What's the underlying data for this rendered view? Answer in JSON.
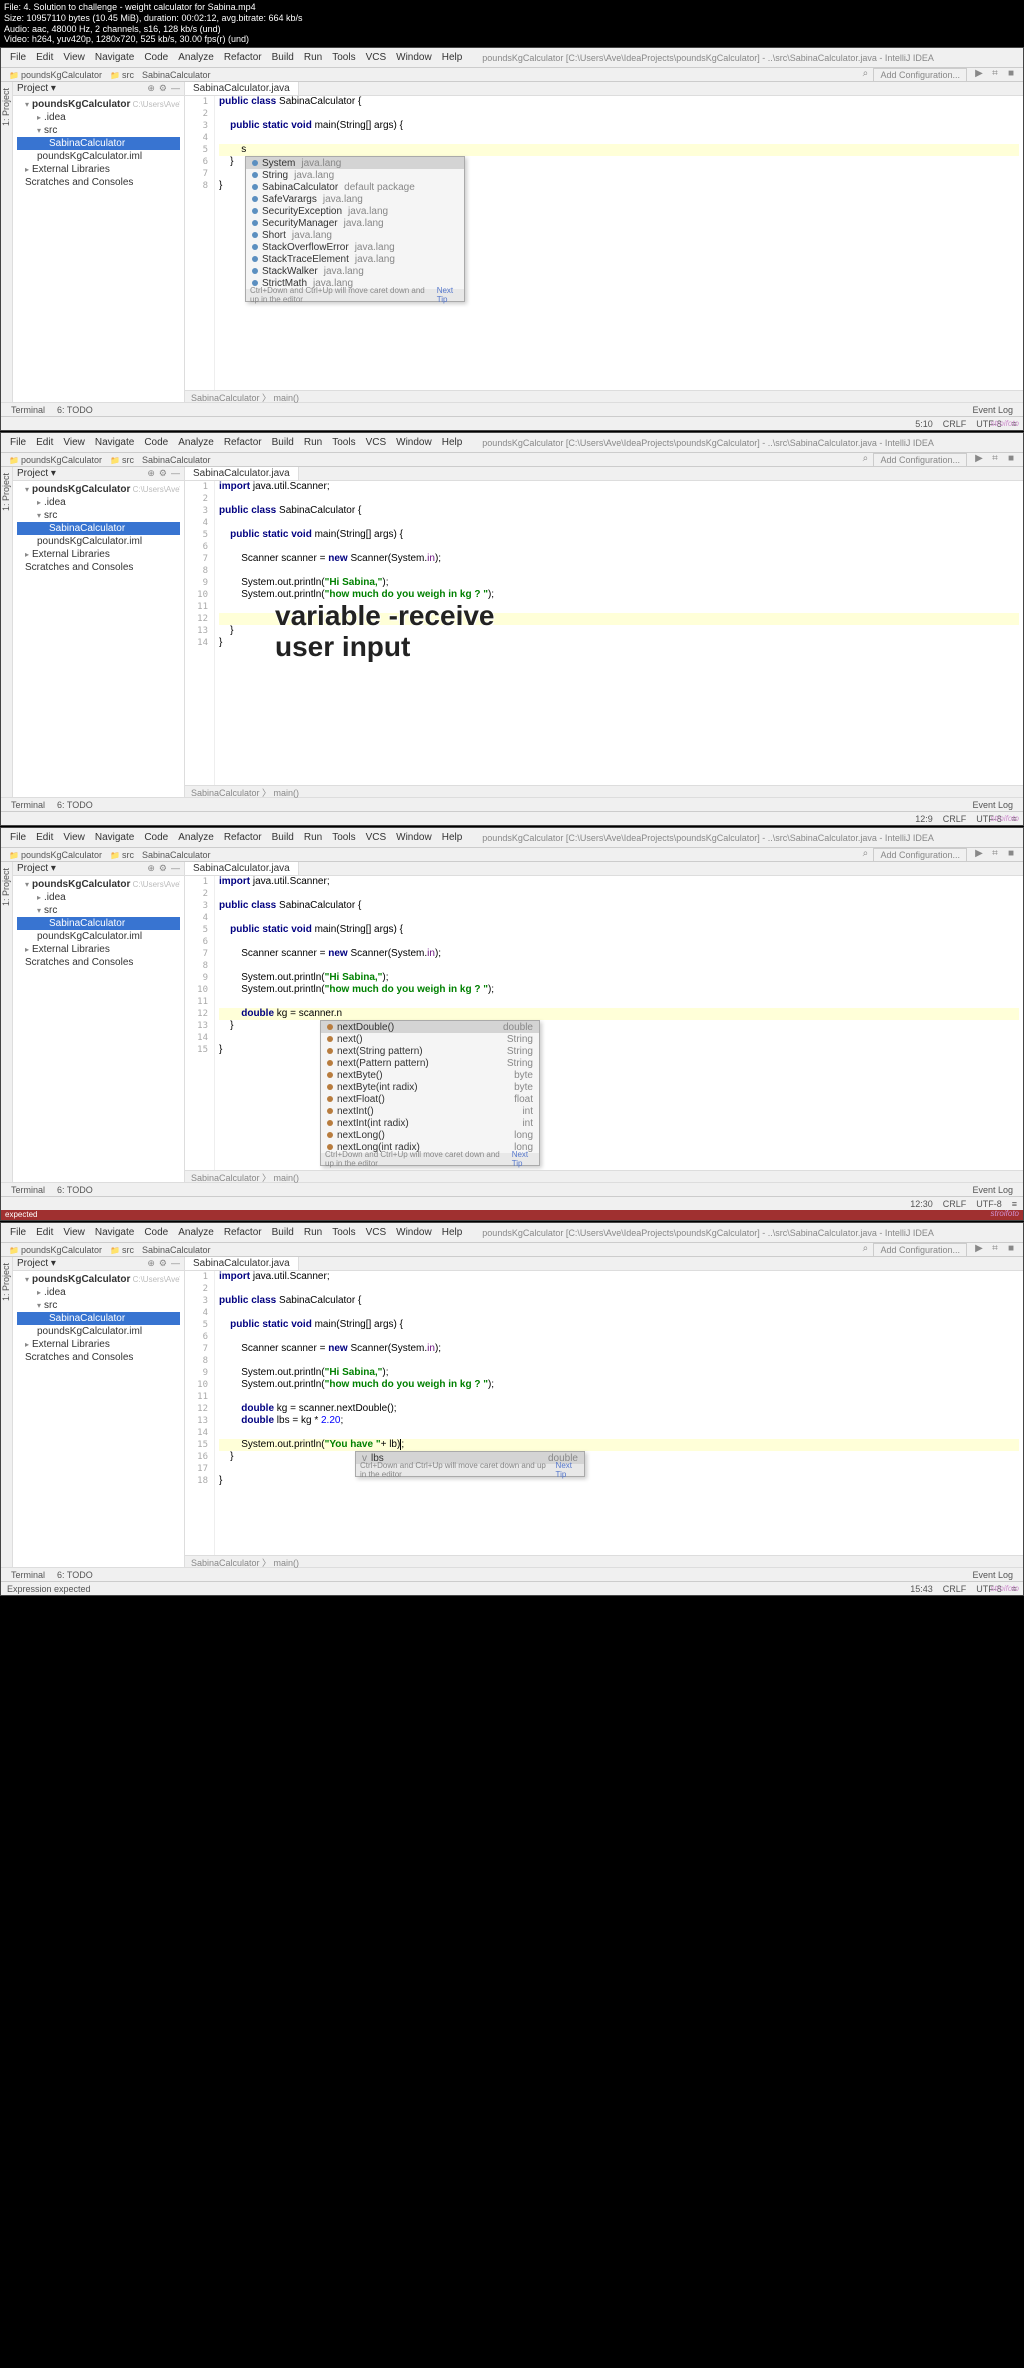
{
  "file_info": {
    "line1": "File: 4. Solution to challenge - weight calculator for Sabina.mp4",
    "line2": "Size: 10957110 bytes (10.45 MiB), duration: 00:02:12, avg.bitrate: 664 kb/s",
    "line3": "Audio: aac, 48000 Hz, 2 channels, s16, 128 kb/s (und)",
    "line4": "Video: h264, yuv420p, 1280x720, 525 kb/s, 30.00 fps(r) (und)"
  },
  "menu": [
    "File",
    "Edit",
    "View",
    "Navigate",
    "Code",
    "Analyze",
    "Refactor",
    "Build",
    "Run",
    "Tools",
    "VCS",
    "Window",
    "Help"
  ],
  "pathbar": "poundsKgCalculator [C:\\Users\\Ave\\IdeaProjects\\poundsKgCalculator] - ..\\src\\SabinaCalculator.java - IntelliJ IDEA",
  "breadcrumbs": {
    "root": "poundsKgCalculator",
    "src": "src",
    "file": "SabinaCalculator"
  },
  "addconfig": "Add Configuration...",
  "project_label": "Project ▾",
  "tree": {
    "root": "poundsKgCalculator",
    "root_hint": " C:\\Users\\Ave\\IdeaProjects\\poundsKgCalculator",
    "idea": ".idea",
    "src": "src",
    "file": "SabinaCalculator",
    "iml": "poundsKgCalculator.iml",
    "ext": "External Libraries",
    "scratch": "Scratches and Consoles"
  },
  "editor_tab": "SabinaCalculator.java",
  "code1": {
    "l1": "public class SabinaCalculator {",
    "l3": "    public static void main(String[] args) {",
    "l5": "        s",
    "l6": "    }",
    "l7": "",
    "l8": "}"
  },
  "popup1": [
    {
      "name": "System",
      "pkg": "java.lang",
      "sel": true
    },
    {
      "name": "String",
      "pkg": "java.lang"
    },
    {
      "name": "SabinaCalculator",
      "pkg": "default package"
    },
    {
      "name": "SafeVarargs",
      "pkg": "java.lang"
    },
    {
      "name": "SecurityException",
      "pkg": "java.lang"
    },
    {
      "name": "SecurityManager",
      "pkg": "java.lang"
    },
    {
      "name": "Short",
      "pkg": "java.lang"
    },
    {
      "name": "StackOverflowError",
      "pkg": "java.lang"
    },
    {
      "name": "StackTraceElement",
      "pkg": "java.lang"
    },
    {
      "name": "StackWalker",
      "pkg": "java.lang"
    },
    {
      "name": "StrictMath",
      "pkg": "java.lang"
    }
  ],
  "popup_footer": "Ctrl+Down and Ctrl+Up will move caret down and up in the editor",
  "popup_footer_link": "Next Tip",
  "bc_bottom": "SabinaCalculator 〉 main()",
  "bottom_tabs": {
    "terminal": "Terminal",
    "todo": "6: TODO",
    "event": "Event Log"
  },
  "status1": {
    "pos": "5:10",
    "enc": "CRLF",
    "cs": "UTF-8",
    "sp": "≡"
  },
  "overlay2": {
    "l1": "variable -receive",
    "l2": "user input"
  },
  "code2": {
    "l1": "import java.util.Scanner;",
    "l3": "public class SabinaCalculator {",
    "l5": "    public static void main(String[] args) {",
    "l7": "        Scanner scanner = new Scanner(System.in);",
    "l9": "        System.out.println(\"Hi Sabina,\");",
    "l10": "        System.out.println(\"how much do you weigh in kg ? \");",
    "l12": "        ",
    "l13": "    }",
    "l14": "}"
  },
  "status2": {
    "pos": "12:9"
  },
  "code3": {
    "l1": "import java.util.Scanner;",
    "l3": "public class SabinaCalculator {",
    "l5": "    public static void main(String[] args) {",
    "l7": "        Scanner scanner = new Scanner(System.in);",
    "l9": "        System.out.println(\"Hi Sabina,\");",
    "l10": "        System.out.println(\"how much do you weigh in kg ? \");",
    "l12": "        double kg = scanner.n",
    "l13": "    }",
    "l14": "",
    "l15": "}"
  },
  "popup3": [
    {
      "name": "nextDouble()",
      "type": "double",
      "sel": true
    },
    {
      "name": "next()",
      "type": "String"
    },
    {
      "name": "next(String pattern)",
      "type": "String"
    },
    {
      "name": "next(Pattern pattern)",
      "type": "String"
    },
    {
      "name": "nextByte()",
      "type": "byte"
    },
    {
      "name": "nextByte(int radix)",
      "type": "byte"
    },
    {
      "name": "nextFloat()",
      "type": "float"
    },
    {
      "name": "nextInt()",
      "type": "int"
    },
    {
      "name": "nextInt(int radix)",
      "type": "int"
    },
    {
      "name": "nextLong()",
      "type": "long"
    },
    {
      "name": "nextLong(int radix)",
      "type": "long"
    }
  ],
  "status3": {
    "pos": "12:30"
  },
  "expected_tab": "expected",
  "code4": {
    "l1": "import java.util.Scanner;",
    "l3": "public class SabinaCalculator {",
    "l5": "    public static void main(String[] args) {",
    "l7": "        Scanner scanner = new Scanner(System.in);",
    "l9": "        System.out.println(\"Hi Sabina,\");",
    "l10": "        System.out.println(\"how much do you weigh in kg ? \");",
    "l12": "        double kg = scanner.nextDouble();",
    "l13": "        double lbs = kg * 2.20;",
    "l15": "        System.out.println(\"You have \"+ lb);",
    "l16": "    }",
    "l18": "}"
  },
  "popup4": {
    "name": "lbs",
    "type": "double"
  },
  "status4": {
    "pos": "15:43",
    "msg": "Expression expected"
  }
}
